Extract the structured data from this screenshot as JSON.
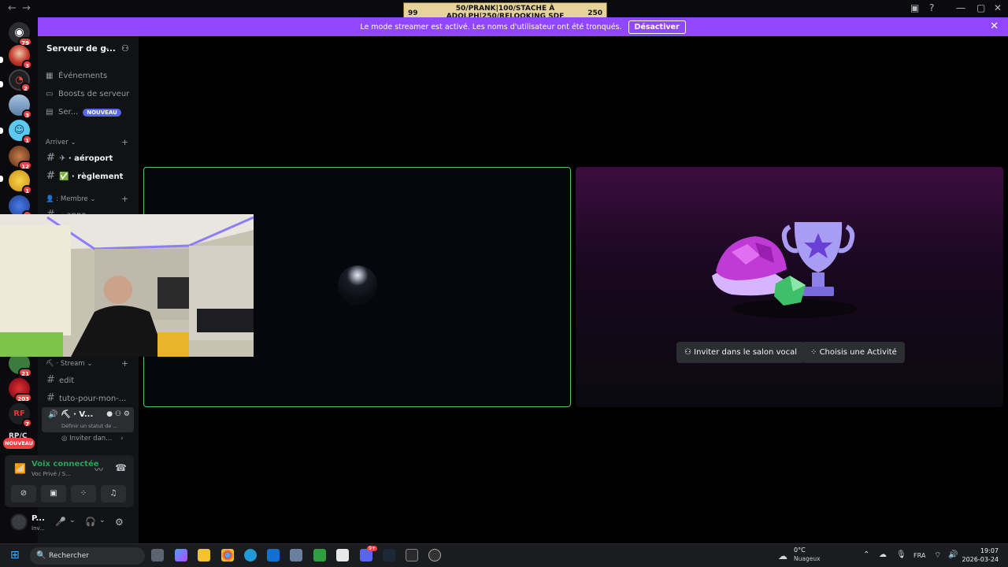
{
  "goal": {
    "text_line1": "50/PRANK|100/STACHE À",
    "text_line2": "ADOLPH|250/RELOOKING SDF",
    "left_value": "99",
    "right_value": "250"
  },
  "banner": {
    "message": "Le mode streamer est activé. Les noms d'utilisateur ont été tronqués.",
    "button": "Désactiver"
  },
  "guilds": [
    {
      "badge": "79"
    },
    {
      "badge": "3"
    },
    {
      "badge": "2"
    },
    {
      "badge": "3"
    },
    {
      "badge": "1"
    },
    {
      "badge": "12"
    },
    {
      "badge": "1"
    },
    {
      "badge": "2"
    },
    {
      "badge": "21"
    },
    {
      "badge": "203"
    },
    {
      "badge": "7"
    }
  ],
  "guild_rail_label": "RP/C",
  "guild_new": "NOUVEAU",
  "server": {
    "name": "Serveur de g..."
  },
  "nav": [
    {
      "label": "Événements"
    },
    {
      "label": "Boosts de serveur"
    },
    {
      "label": "Ser...",
      "badge": "NOUVEAU"
    }
  ],
  "categories": [
    {
      "label": "Arriver"
    },
    {
      "label": "Membre"
    },
    {
      "label": "Stream"
    }
  ],
  "channels": {
    "aeroport": "aéroport",
    "reglement": "règlement",
    "membre_partial": "anno",
    "edit": "edit",
    "tuto": "tuto-pour-mon-..."
  },
  "voice_channel": {
    "name": "V...",
    "status": "Définir un statut de ..."
  },
  "invite_row": "Inviter dan...",
  "voice_panel": {
    "status": "Voix connectée",
    "sub": "Voc Privé / S..."
  },
  "user": {
    "name": "P...",
    "status": "Inv..."
  },
  "stage": {
    "invite_button": "Inviter dans le salon vocal",
    "activity_button": "Choisis une Activité"
  },
  "taskbar": {
    "search": "Rechercher",
    "weather_temp": "0°C",
    "weather_desc": "Nuageux",
    "lang": "FRA",
    "time": "19:07",
    "date": "2026-03-24",
    "discord_badge": "9+"
  },
  "colors": {
    "accent": "#9146ff",
    "online": "#23a55a",
    "blurple": "#5865f2",
    "danger": "#f23f43"
  }
}
